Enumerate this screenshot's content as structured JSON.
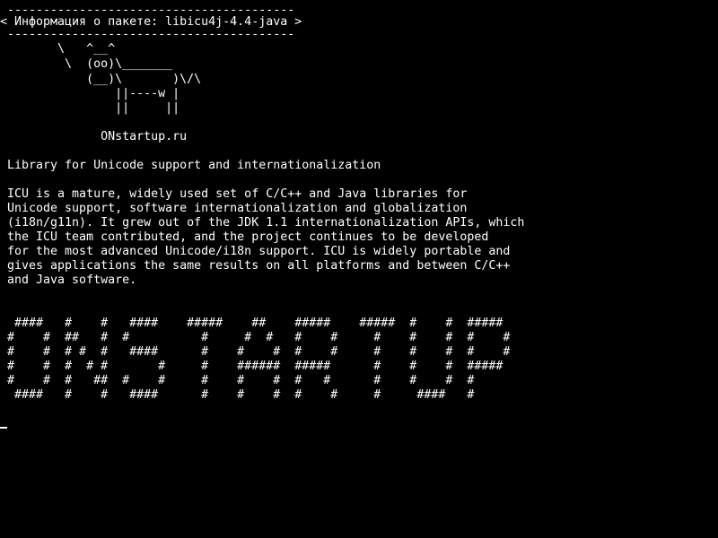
{
  "colors": {
    "background": "#000000",
    "foreground": "#ffffff"
  },
  "terminal": {
    "lines": [
      " ----------------------------------------",
      "< Информация о пакете: libicu4j-4.4-java >",
      " ----------------------------------------",
      "        \\   ^__^",
      "         \\  (oo)\\_______",
      "            (__)\\       )\\/\\",
      "                ||----w |",
      "                ||     ||",
      "",
      "              ONstartup.ru",
      "",
      " Library for Unicode support and internationalization",
      "",
      " ICU is a mature, widely used set of C/C++ and Java libraries for",
      " Unicode support, software internationalization and globalization",
      " (i18n/g11n). It grew out of the JDK 1.1 internationalization APIs, which",
      " the ICU team contributed, and the project continues to be developed",
      " for the most advanced Unicode/i18n support. ICU is widely portable and",
      " gives applications the same results on all platforms and between C/C++",
      " and Java software.",
      "",
      "",
      "  ####   #    #   ####    #####    ##    #####    #####  #    #  #####",
      " #    #  ##   #  #          #     #  #   #    #     #    #    #  #    #",
      " #    #  # #  #   ####      #    #    #  #    #     #    #    #  #    #",
      " #    #  #  # #       #     #    ######  #####      #    #    #  #####",
      " #    #  #   ##  #    #     #    #    #  #   #      #    #    #  #",
      "  ####   #    #   ####      #    #    #  #    #     #     ####   #"
    ]
  }
}
